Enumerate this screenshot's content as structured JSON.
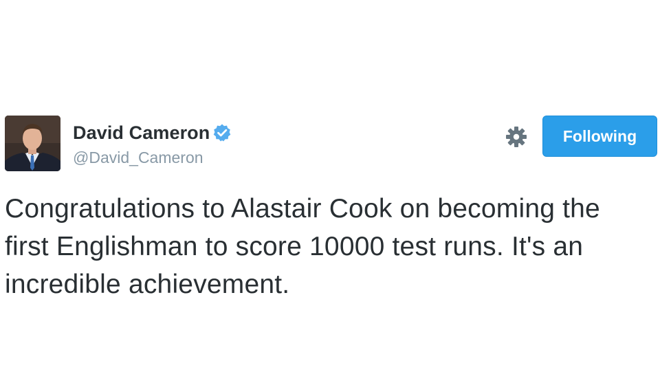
{
  "user": {
    "display_name": "David Cameron",
    "handle": "@David_Cameron",
    "verified": true
  },
  "actions": {
    "follow_label": "Following",
    "settings_icon": "gear-icon"
  },
  "tweet": {
    "text": "Congratulations to Alastair Cook on becoming the first Englishman to score 10000 test runs. It's an incredible achievement."
  },
  "colors": {
    "accent": "#2b9ee9",
    "verified": "#55acee",
    "handle": "#8899a6",
    "text": "#292f33",
    "gear": "#66757f"
  }
}
